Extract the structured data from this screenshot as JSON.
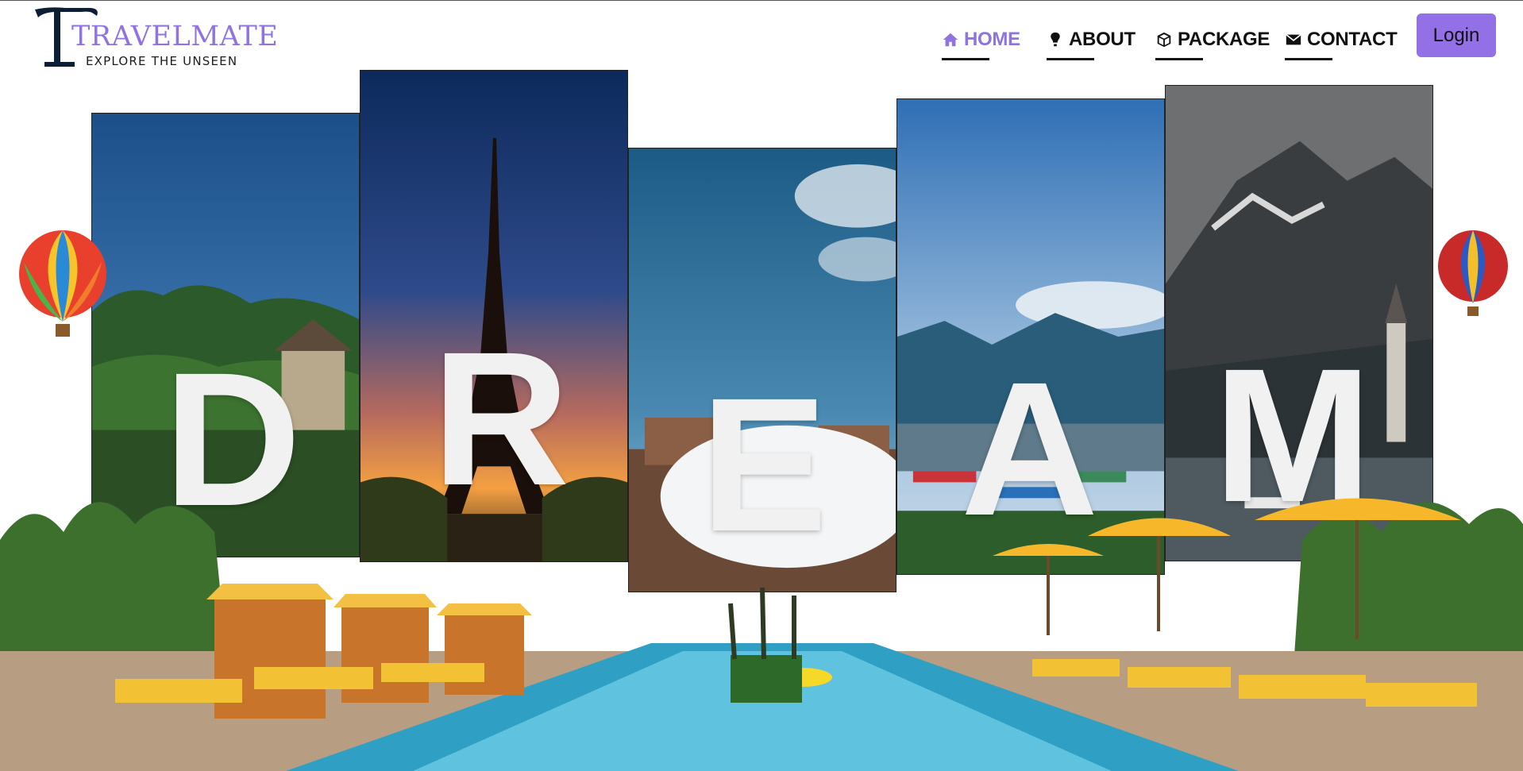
{
  "brand": {
    "name": "TRAVELMATE",
    "tagline": "EXPLORE THE UNSEEN",
    "accent_color": "#8f73e3"
  },
  "nav": {
    "items": [
      {
        "label": "HOME",
        "icon": "home-icon",
        "active": true
      },
      {
        "label": "ABOUT",
        "icon": "bulb-icon",
        "active": false
      },
      {
        "label": "PACKAGE",
        "icon": "box-icon",
        "active": false
      },
      {
        "label": "CONTACT",
        "icon": "envelope-icon",
        "active": false
      }
    ],
    "login_label": "Login",
    "login_color": "#9370e6"
  },
  "hero": {
    "letters": [
      "D",
      "R",
      "E",
      "A",
      "M"
    ],
    "panels": [
      "tropical-temple",
      "eiffel-tower",
      "plaza-sky",
      "lake-boats",
      "alpine-village"
    ]
  }
}
